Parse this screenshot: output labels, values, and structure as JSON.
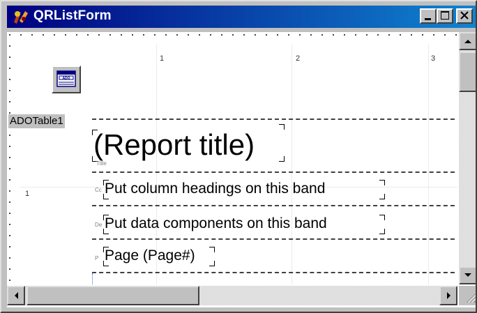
{
  "window": {
    "title": "QRListForm"
  },
  "ruler": {
    "h_marks": [
      "1",
      "2",
      "3"
    ],
    "v_marks": [
      "1"
    ]
  },
  "component": {
    "name": "ADOTable1",
    "icon_text": "ADO"
  },
  "bands": {
    "title": {
      "text": "(Report title)",
      "tag": "Title"
    },
    "column_header": {
      "text": "Put column headings on this band",
      "tag": "Cc"
    },
    "detail": {
      "text": "Put data components on this band",
      "tag": "De"
    },
    "page_footer": {
      "text": "Page (Page#)",
      "tag": "P"
    }
  },
  "colors": {
    "title_bar_start": "#000080",
    "title_bar_end": "#1084d0",
    "face": "#c0c0c0"
  },
  "icons": [
    "app-icon",
    "minimize-icon",
    "maximize-icon",
    "close-icon",
    "scroll-up-icon",
    "scroll-down-icon",
    "scroll-left-icon",
    "scroll-right-icon",
    "ado-table-icon"
  ]
}
